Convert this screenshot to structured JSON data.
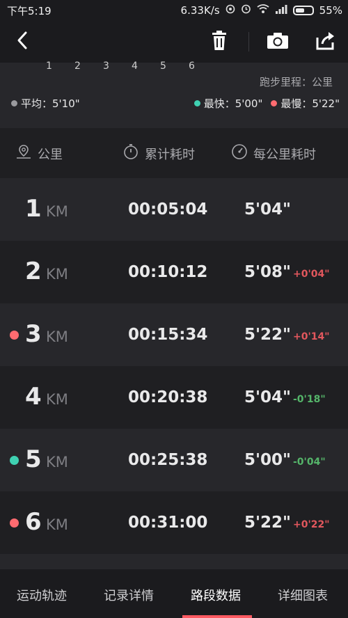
{
  "status_bar": {
    "time": "下午5:19",
    "network_speed": "6.33K/s",
    "battery": "55%",
    "battery_level": 0.55
  },
  "toolbar": {
    "back_icon": "back-icon",
    "delete_icon": "trash-icon",
    "camera_icon": "camera-icon",
    "share_icon": "share-icon"
  },
  "chart": {
    "ticks": [
      "1",
      "2",
      "3",
      "4",
      "5",
      "6"
    ],
    "unit_label": "跑步里程：公里",
    "average": "平均：5'10\"",
    "fastest": "最快：5'00\"",
    "slowest": "最慢：5'22\""
  },
  "colors": {
    "fast": "#3fd1b2",
    "slow": "#ff6b70",
    "avg": "#9a9a9e",
    "diff_up": "#e2575d",
    "diff_down": "#55b56a"
  },
  "table": {
    "headers": {
      "km": "公里",
      "cumulative": "累计耗时",
      "pace": "每公里耗时"
    },
    "unit": "KM",
    "rows": [
      {
        "km": "1",
        "time": "00:05:04",
        "pace": "5'04\"",
        "diff": "",
        "marker": ""
      },
      {
        "km": "2",
        "time": "00:10:12",
        "pace": "5'08\"",
        "diff": "+0'04\"",
        "marker": ""
      },
      {
        "km": "3",
        "time": "00:15:34",
        "pace": "5'22\"",
        "diff": "+0'14\"",
        "marker": "slow"
      },
      {
        "km": "4",
        "time": "00:20:38",
        "pace": "5'04\"",
        "diff": "-0'18\"",
        "marker": ""
      },
      {
        "km": "5",
        "time": "00:25:38",
        "pace": "5'00\"",
        "diff": "-0'04\"",
        "marker": "fast"
      },
      {
        "km": "6",
        "time": "00:31:00",
        "pace": "5'22\"",
        "diff": "+0'22\"",
        "marker": "slow"
      }
    ]
  },
  "bottom_tabs": [
    "运动轨迹",
    "记录详情",
    "路段数据",
    "详细图表"
  ],
  "active_tab": "路段数据"
}
